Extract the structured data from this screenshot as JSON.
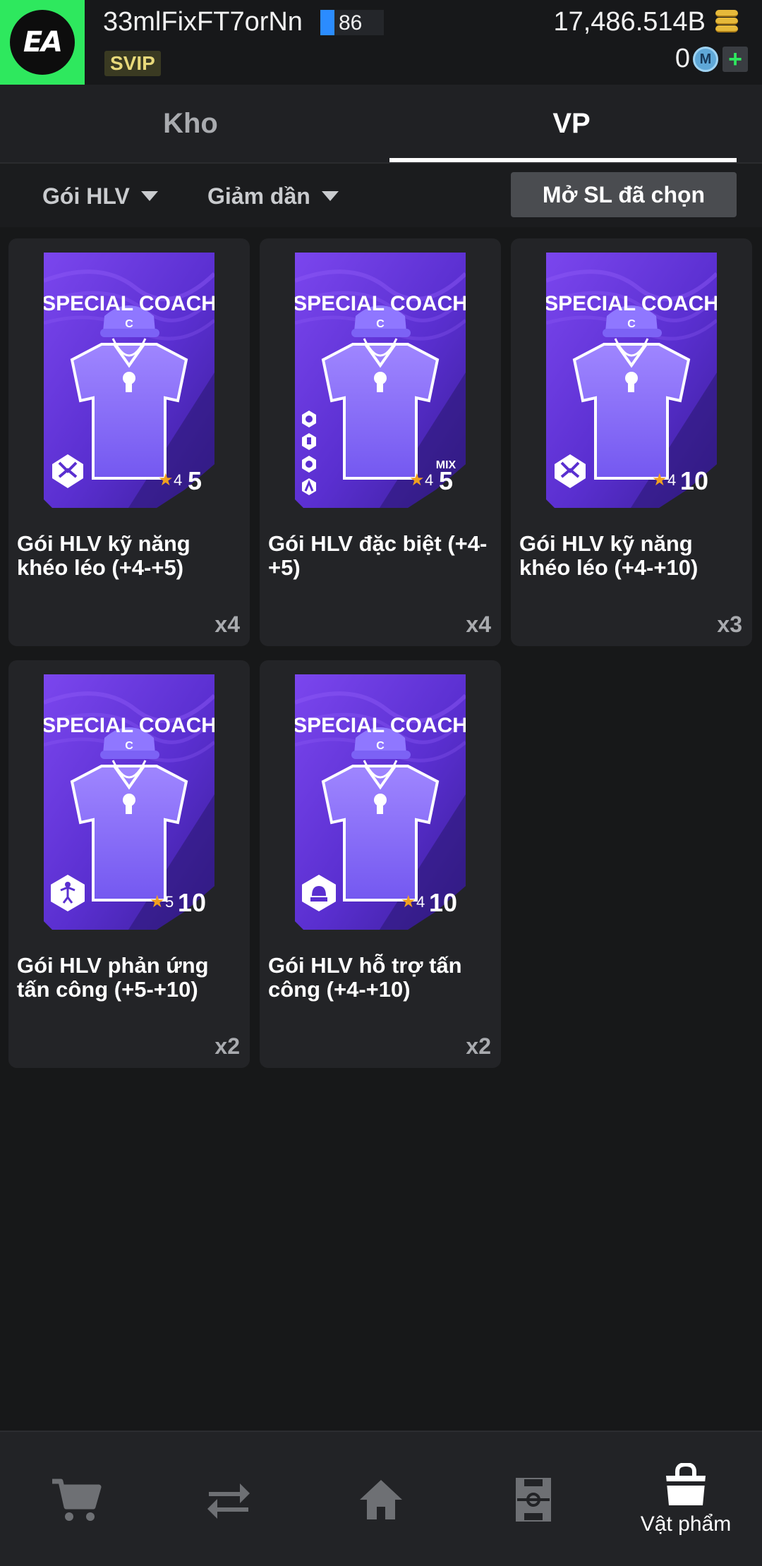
{
  "header": {
    "logo_text": "EA",
    "username": "33mlFixFT7orNn",
    "level": "86",
    "vip_badge": "SVIP",
    "coins": "17,486.514B",
    "m_coins": "0",
    "m_icon_letter": "M",
    "plus": "+"
  },
  "tabs": [
    {
      "label": "Kho",
      "active": false
    },
    {
      "label": "VP",
      "active": true
    }
  ],
  "filters": {
    "type": "Gói HLV",
    "sort": "Giảm dần",
    "open_selected": "Mở SL đã chọn"
  },
  "pack_label": "SPECIAL COACH",
  "pack_hat_letter": "C",
  "items": [
    {
      "title": "Gói HLV kỹ năng khéo léo (+4-+5)",
      "qty": "x4",
      "star_min": "4",
      "star_max": "5",
      "mix": "",
      "icon": "dribble-icon"
    },
    {
      "title": "Gói HLV đặc biệt (+4-+5)",
      "qty": "x4",
      "star_min": "4",
      "star_max": "5",
      "mix": "MIX",
      "icon": "mix-icons"
    },
    {
      "title": "Gói HLV kỹ năng khéo léo (+4-+10)",
      "qty": "x3",
      "star_min": "4",
      "star_max": "10",
      "mix": "",
      "icon": "dribble-icon"
    },
    {
      "title": "Gói HLV phản ứng tấn công (+5-+10)",
      "qty": "x2",
      "star_min": "5",
      "star_max": "10",
      "mix": "",
      "icon": "attack-reaction-icon"
    },
    {
      "title": "Gói HLV hỗ trợ tấn công (+4-+10)",
      "qty": "x2",
      "star_min": "4",
      "star_max": "10",
      "mix": "",
      "icon": "attack-support-icon"
    }
  ],
  "nav": [
    {
      "name": "shop",
      "label": "",
      "icon": "cart-icon"
    },
    {
      "name": "transfer",
      "label": "",
      "icon": "transfer-icon"
    },
    {
      "name": "home",
      "label": "",
      "icon": "home-icon"
    },
    {
      "name": "squad",
      "label": "",
      "icon": "pitch-icon"
    },
    {
      "name": "items",
      "label": "Vật phẩm",
      "icon": "bag-icon",
      "active": true
    }
  ],
  "colors": {
    "accent_green": "#2ee85e",
    "pack_purple": "#6a3fe0",
    "star": "#f0a020"
  }
}
